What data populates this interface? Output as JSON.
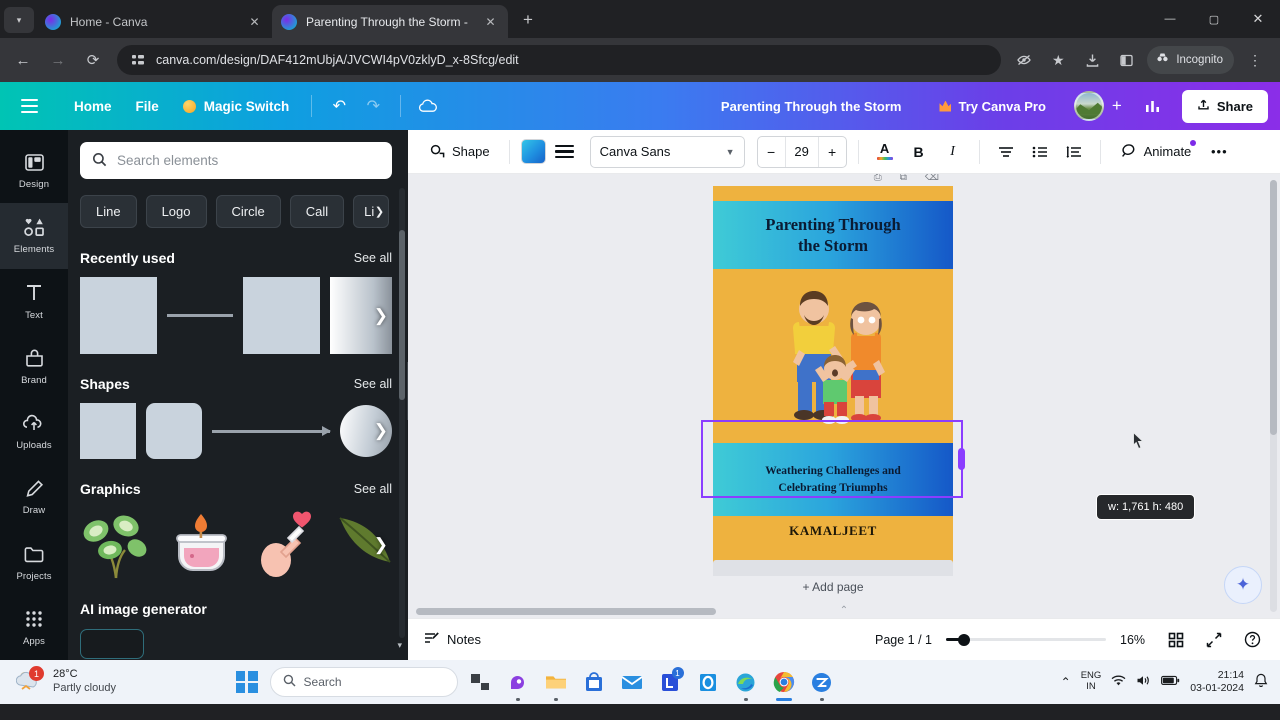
{
  "browser": {
    "tabs": [
      {
        "title": "Home - Canva",
        "active": false,
        "favicon": "canva-favicon"
      },
      {
        "title": "Parenting Through the Storm -",
        "active": true,
        "favicon": "canva-favicon"
      }
    ],
    "new_tab_label": "+",
    "tabstrip_chevron": "▾",
    "window_controls": {
      "minimize": "—",
      "maximize": "▢",
      "close": "✕"
    },
    "nav": {
      "back": "←",
      "forward": "→",
      "reload": "⟳"
    },
    "omnibox": {
      "url": "canva.com/design/DAF412mUbjA/JVCWI4pV0zklyD_x-8Sfcg/edit",
      "site_icon": "site-settings-icon"
    },
    "toolbar_icons": [
      "eye-off-icon",
      "bookmark-star-icon",
      "download-icon",
      "split-view-icon"
    ],
    "incognito_label": "Incognito",
    "menu_label": "⋮"
  },
  "canva": {
    "topbar": {
      "menu_label": "hamburger-menu",
      "home": "Home",
      "file": "File",
      "magic_switch": "Magic Switch",
      "undo": "↶",
      "redo": "↷",
      "cloud": "☁",
      "doc_title": "Parenting Through the Storm",
      "try_pro": "Try Canva Pro",
      "avatar_plus": "+",
      "insights": "insights-icon",
      "share": "Share"
    },
    "rail": [
      {
        "label": "Design",
        "icon": "design-icon",
        "active": false
      },
      {
        "label": "Elements",
        "icon": "elements-icon",
        "active": true
      },
      {
        "label": "Text",
        "icon": "text-icon",
        "active": false
      },
      {
        "label": "Brand",
        "icon": "brand-icon",
        "active": false
      },
      {
        "label": "Uploads",
        "icon": "uploads-icon",
        "active": false
      },
      {
        "label": "Draw",
        "icon": "draw-icon",
        "active": false
      },
      {
        "label": "Projects",
        "icon": "projects-icon",
        "active": false
      },
      {
        "label": "Apps",
        "icon": "apps-icon",
        "active": false
      }
    ],
    "panel": {
      "search_placeholder": "Search elements",
      "search_value": "",
      "chips": [
        "Line",
        "Logo",
        "Circle",
        "Call",
        "Li"
      ],
      "sections": [
        {
          "title": "Recently used",
          "see_all": "See all"
        },
        {
          "title": "Shapes",
          "see_all": "See all"
        },
        {
          "title": "Graphics",
          "see_all": "See all"
        }
      ],
      "ai_generator_title": "AI image generator"
    },
    "toolbar": {
      "shape_label": "Shape",
      "color_swatch": "#2392dd",
      "lines_icon": "text-lines-icon",
      "font_name": "Canva Sans",
      "font_size": "29",
      "size_minus": "−",
      "size_plus": "+",
      "bold": "B",
      "italic": "I",
      "text_color": "text-color-icon",
      "align": "align-icon",
      "list": "bullet-list-icon",
      "spacing": "line-spacing-icon",
      "animate": "Animate",
      "more": "•••"
    },
    "canvas": {
      "cover": {
        "title": "Parenting Through\nthe Storm",
        "subtitle": "Weathering Challenges and\nCelebrating Triumphs",
        "author": "KAMALJEET",
        "bg_color": "#eeb23f",
        "band_gradient_start": "#3fcbd6",
        "band_gradient_end": "#1558c8",
        "title_color": "#0a1b33"
      },
      "selection_tooltip": "w: 1,761 h: 480",
      "selection_color": "#8b3dff",
      "add_page_label": "+ Add page"
    },
    "status": {
      "notes": "Notes",
      "page_count": "Page 1 / 1",
      "zoom": "16%",
      "grid_icon": "grid-view-icon",
      "fullscreen_icon": "fullscreen-icon",
      "help_icon": "help-icon"
    }
  },
  "taskbar": {
    "weather": {
      "temp": "28°C",
      "condition": "Partly cloudy",
      "badge": "1"
    },
    "search_placeholder": "Search",
    "apps": [
      {
        "name": "task-view-icon",
        "glyph": "▟",
        "color": "#3a3f45",
        "underline": false
      },
      {
        "name": "copilot-icon",
        "glyph": "◗",
        "color": "#8b3fe0",
        "underline": true
      },
      {
        "name": "file-explorer-icon",
        "glyph": "▰",
        "color": "#f3b33d",
        "underline": true
      },
      {
        "name": "microsoft-store-icon",
        "glyph": "▣",
        "color": "#2a6fd8",
        "underline": false
      },
      {
        "name": "mail-icon",
        "glyph": "✉",
        "color": "#2a8fe0",
        "underline": false
      },
      {
        "name": "office-loop-icon",
        "glyph": "◧",
        "color": "#2a4fd8",
        "underline": false,
        "badge": "1"
      },
      {
        "name": "blue-app-icon",
        "glyph": "◎",
        "color": "#1a8fe0",
        "underline": false
      },
      {
        "name": "edge-icon",
        "glyph": "◉",
        "color": "#2aa5d8",
        "underline": true
      },
      {
        "name": "chrome-icon",
        "glyph": "◉",
        "color": "#e8453c",
        "underline": "wide"
      },
      {
        "name": "zoom-icon",
        "glyph": "Z",
        "color": "#2a7fe0",
        "underline": true
      }
    ],
    "tray": {
      "language": "ENG",
      "region": "IN",
      "wifi": "wifi-icon",
      "volume": "volume-icon",
      "battery": "battery-icon",
      "time": "21:14",
      "date": "03-01-2024",
      "notification": "bell-icon"
    }
  }
}
